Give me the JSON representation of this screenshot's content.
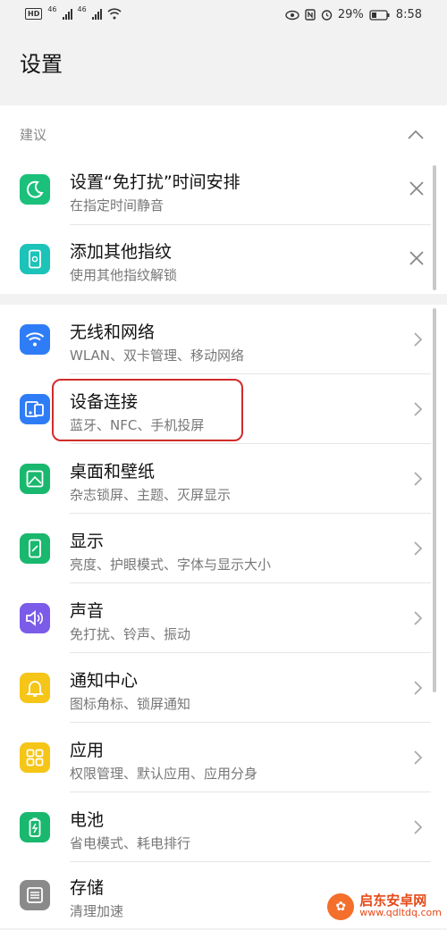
{
  "status_bar": {
    "hd": "HD",
    "net1": "46",
    "net2": "46",
    "battery": "29%",
    "time": "8:58"
  },
  "header": {
    "title": "设置"
  },
  "suggestions": {
    "label": "建议",
    "items": [
      {
        "title": "设置“免打扰”时间安排",
        "subtitle": "在指定时间静音",
        "icon": "moon-icon",
        "color": "#1bc07a"
      },
      {
        "title": "添加其他指纹",
        "subtitle": "使用其他指纹解锁",
        "icon": "fingerprint-phone-icon",
        "color": "#1bc3b8"
      }
    ]
  },
  "settings": {
    "items": [
      {
        "title": "无线和网络",
        "subtitle": "WLAN、双卡管理、移动网络",
        "icon": "wifi-icon",
        "color": "#2f7df6"
      },
      {
        "title": "设备连接",
        "subtitle": "蓝牙、NFC、手机投屏",
        "icon": "device-connect-icon",
        "color": "#2f7df6"
      },
      {
        "title": "桌面和壁纸",
        "subtitle": "杂志锁屏、主题、灭屏显示",
        "icon": "wallpaper-icon",
        "color": "#19b86e"
      },
      {
        "title": "显示",
        "subtitle": "亮度、护眼模式、字体与显示大小",
        "icon": "display-icon",
        "color": "#19b86e"
      },
      {
        "title": "声音",
        "subtitle": "免打扰、铃声、振动",
        "icon": "speaker-icon",
        "color": "#7a5ce8"
      },
      {
        "title": "通知中心",
        "subtitle": "图标角标、锁屏通知",
        "icon": "bell-icon",
        "color": "#f5c518"
      },
      {
        "title": "应用",
        "subtitle": "权限管理、默认应用、应用分身",
        "icon": "apps-grid-icon",
        "color": "#f5c518"
      },
      {
        "title": "电池",
        "subtitle": "省电模式、耗电排行",
        "icon": "battery-icon",
        "color": "#19b86e"
      },
      {
        "title": "存储",
        "subtitle": "清理加速",
        "icon": "storage-icon",
        "color": "#8a8a8a"
      }
    ]
  },
  "watermark": {
    "name": "启东安卓网",
    "url": "www.qdltdq.com"
  }
}
